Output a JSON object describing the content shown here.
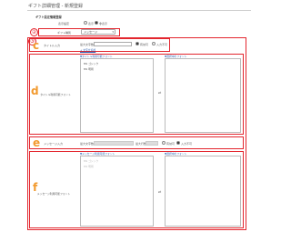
{
  "page": {
    "title": "ギフト詳細管理 - 新規登録"
  },
  "section": {
    "title": "ギフト設定情報登録"
  },
  "display_setting": {
    "label": "表示設定",
    "options": [
      {
        "label": "表示",
        "selected": false
      },
      {
        "label": "非表示",
        "selected": true
      }
    ]
  },
  "gift_type": {
    "label": "ギフト種別",
    "value": "メッセージ"
  },
  "annotations": {
    "num2": "②",
    "num3": "③",
    "c": "c",
    "d": "d",
    "e": "e",
    "f": "f"
  },
  "title_input": {
    "label": "タイトル入力",
    "max_chars_label": "最大文字数",
    "options": [
      {
        "label": "有効可",
        "selected": true
      },
      {
        "label": "入力不可",
        "selected": false
      }
    ],
    "link": "+ 文字を追加"
  },
  "title_font": {
    "caption": "タイトル利用可能フォント",
    "left_panel_title": "▼タイトル利用可能フォント",
    "left_items": [
      "MS ゴシック",
      "MS 明朝"
    ],
    "right_panel_title": "▼選択中のフォント",
    "right_items": []
  },
  "message_input": {
    "label": "メッセージ入力",
    "max_chars_label": "最大文字数",
    "max_lines_label": "最大行数",
    "options": [
      {
        "label": "有効可",
        "selected": false
      },
      {
        "label": "入力不可",
        "selected": true
      }
    ]
  },
  "message_font": {
    "caption": "メッセージ利用可能フォント",
    "left_panel_title": "▼メッセージ利用可能フォント",
    "left_items": [
      "MS ゴシック",
      "MS 明朝"
    ],
    "right_panel_title": "▼選択中のフォント",
    "right_items": []
  },
  "move_arrow": "⇌",
  "colors": {
    "annotation_red": "#e3262e",
    "annotation_orange": "#f29a2e",
    "link_blue": "#2a5db0"
  }
}
